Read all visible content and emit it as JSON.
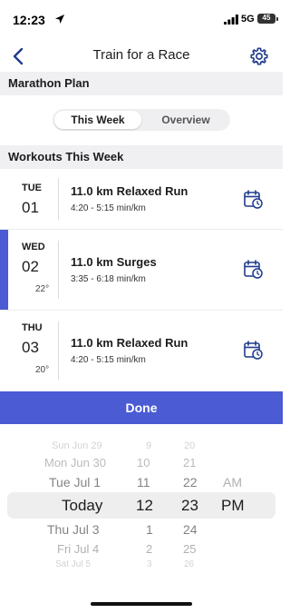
{
  "status": {
    "time": "12:23",
    "network": "5G",
    "battery": "45"
  },
  "nav": {
    "title": "Train for a Race"
  },
  "plan_header": "Marathon Plan",
  "segment": {
    "active": "This Week",
    "inactive": "Overview"
  },
  "workouts_header": "Workouts This Week",
  "workouts": [
    {
      "dow": "TUE",
      "day": "01",
      "temp": "",
      "title": "11.0 km Relaxed Run",
      "pace": "4:20 - 5:15 min/km",
      "selected": false
    },
    {
      "dow": "WED",
      "day": "02",
      "temp": "22°",
      "title": "11.0 km Surges",
      "pace": "3:35 - 6:18 min/km",
      "selected": true
    },
    {
      "dow": "THU",
      "day": "03",
      "temp": "20°",
      "title": "11.0 km Relaxed Run",
      "pace": "4:20 - 5:15 min/km",
      "selected": false
    }
  ],
  "done_label": "Done",
  "picker": {
    "day_column": [
      "Sun Jun 29",
      "Mon Jun 30",
      "Tue Jul 1",
      "Today",
      "Thu Jul 3",
      "Fri Jul 4",
      "Sat Jul 5"
    ],
    "hour_column": [
      "9",
      "10",
      "11",
      "12",
      "1",
      "2",
      "3"
    ],
    "minute_column": [
      "20",
      "21",
      "22",
      "23",
      "24",
      "25",
      "26"
    ],
    "ampm_column": [
      "AM",
      "PM"
    ],
    "selected": {
      "day": "Today",
      "hour": "12",
      "minute": "23",
      "ampm": "PM"
    }
  },
  "colors": {
    "accent": "#4a5bd4",
    "nav_icon": "#1f3b8c",
    "section_bg": "#f0f0f2"
  },
  "icons": {
    "back": "chevron-left",
    "settings": "gear",
    "calendar": "calendar-clock"
  }
}
